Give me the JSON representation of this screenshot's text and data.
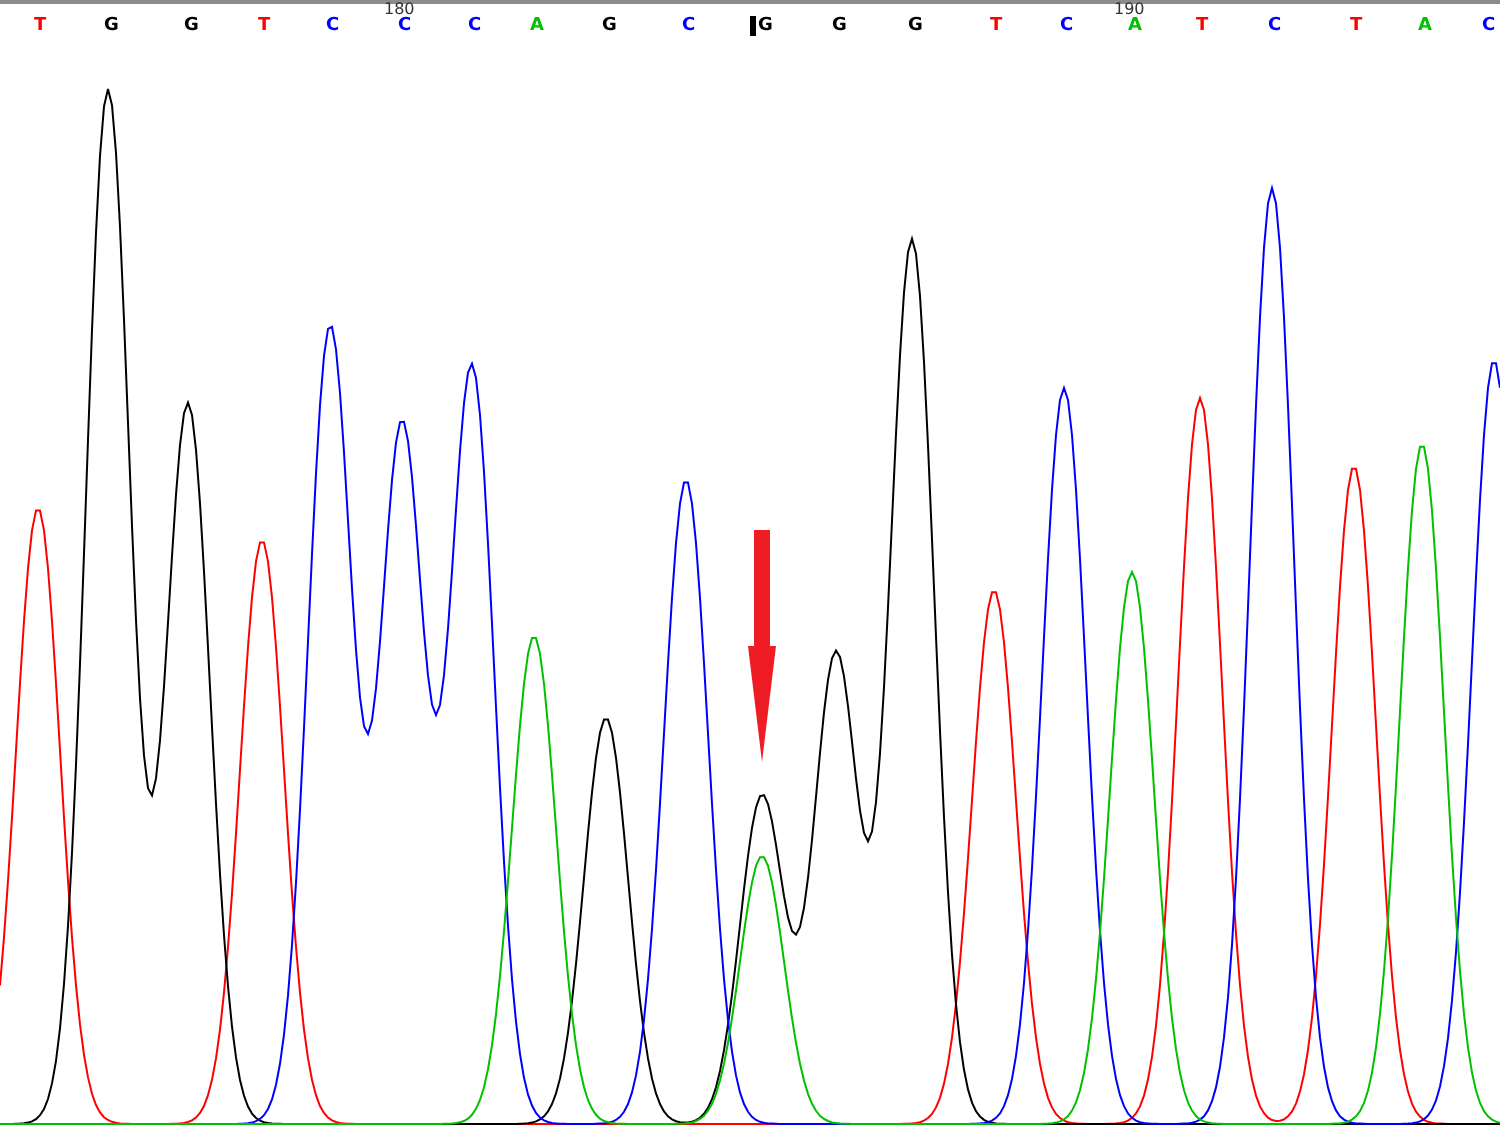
{
  "ruler": [
    {
      "label": "180"
    },
    {
      "label": "190"
    }
  ],
  "bases": [
    {
      "letter": "T",
      "color": "#ff0000",
      "selected": false
    },
    {
      "letter": "G",
      "color": "#000000",
      "selected": false
    },
    {
      "letter": "G",
      "color": "#000000",
      "selected": false
    },
    {
      "letter": "T",
      "color": "#ff0000",
      "selected": false
    },
    {
      "letter": "C",
      "color": "#0000ff",
      "selected": false
    },
    {
      "letter": "C",
      "color": "#0000ff",
      "selected": false
    },
    {
      "letter": "C",
      "color": "#0000ff",
      "selected": false
    },
    {
      "letter": "A",
      "color": "#00c000",
      "selected": false
    },
    {
      "letter": "G",
      "color": "#000000",
      "selected": false
    },
    {
      "letter": "C",
      "color": "#0000ff",
      "selected": false
    },
    {
      "letter": "G",
      "color": "#000000",
      "selected": true
    },
    {
      "letter": "G",
      "color": "#000000",
      "selected": false
    },
    {
      "letter": "G",
      "color": "#000000",
      "selected": false
    },
    {
      "letter": "T",
      "color": "#ff0000",
      "selected": false
    },
    {
      "letter": "C",
      "color": "#0000ff",
      "selected": false
    },
    {
      "letter": "A",
      "color": "#00c000",
      "selected": false
    },
    {
      "letter": "T",
      "color": "#ff0000",
      "selected": false
    },
    {
      "letter": "C",
      "color": "#0000ff",
      "selected": false
    },
    {
      "letter": "T",
      "color": "#ff0000",
      "selected": false
    },
    {
      "letter": "A",
      "color": "#00c000",
      "selected": false
    },
    {
      "letter": "C",
      "color": "#0000ff",
      "selected": false
    }
  ],
  "annotation": {
    "kind": "arrow"
  }
}
